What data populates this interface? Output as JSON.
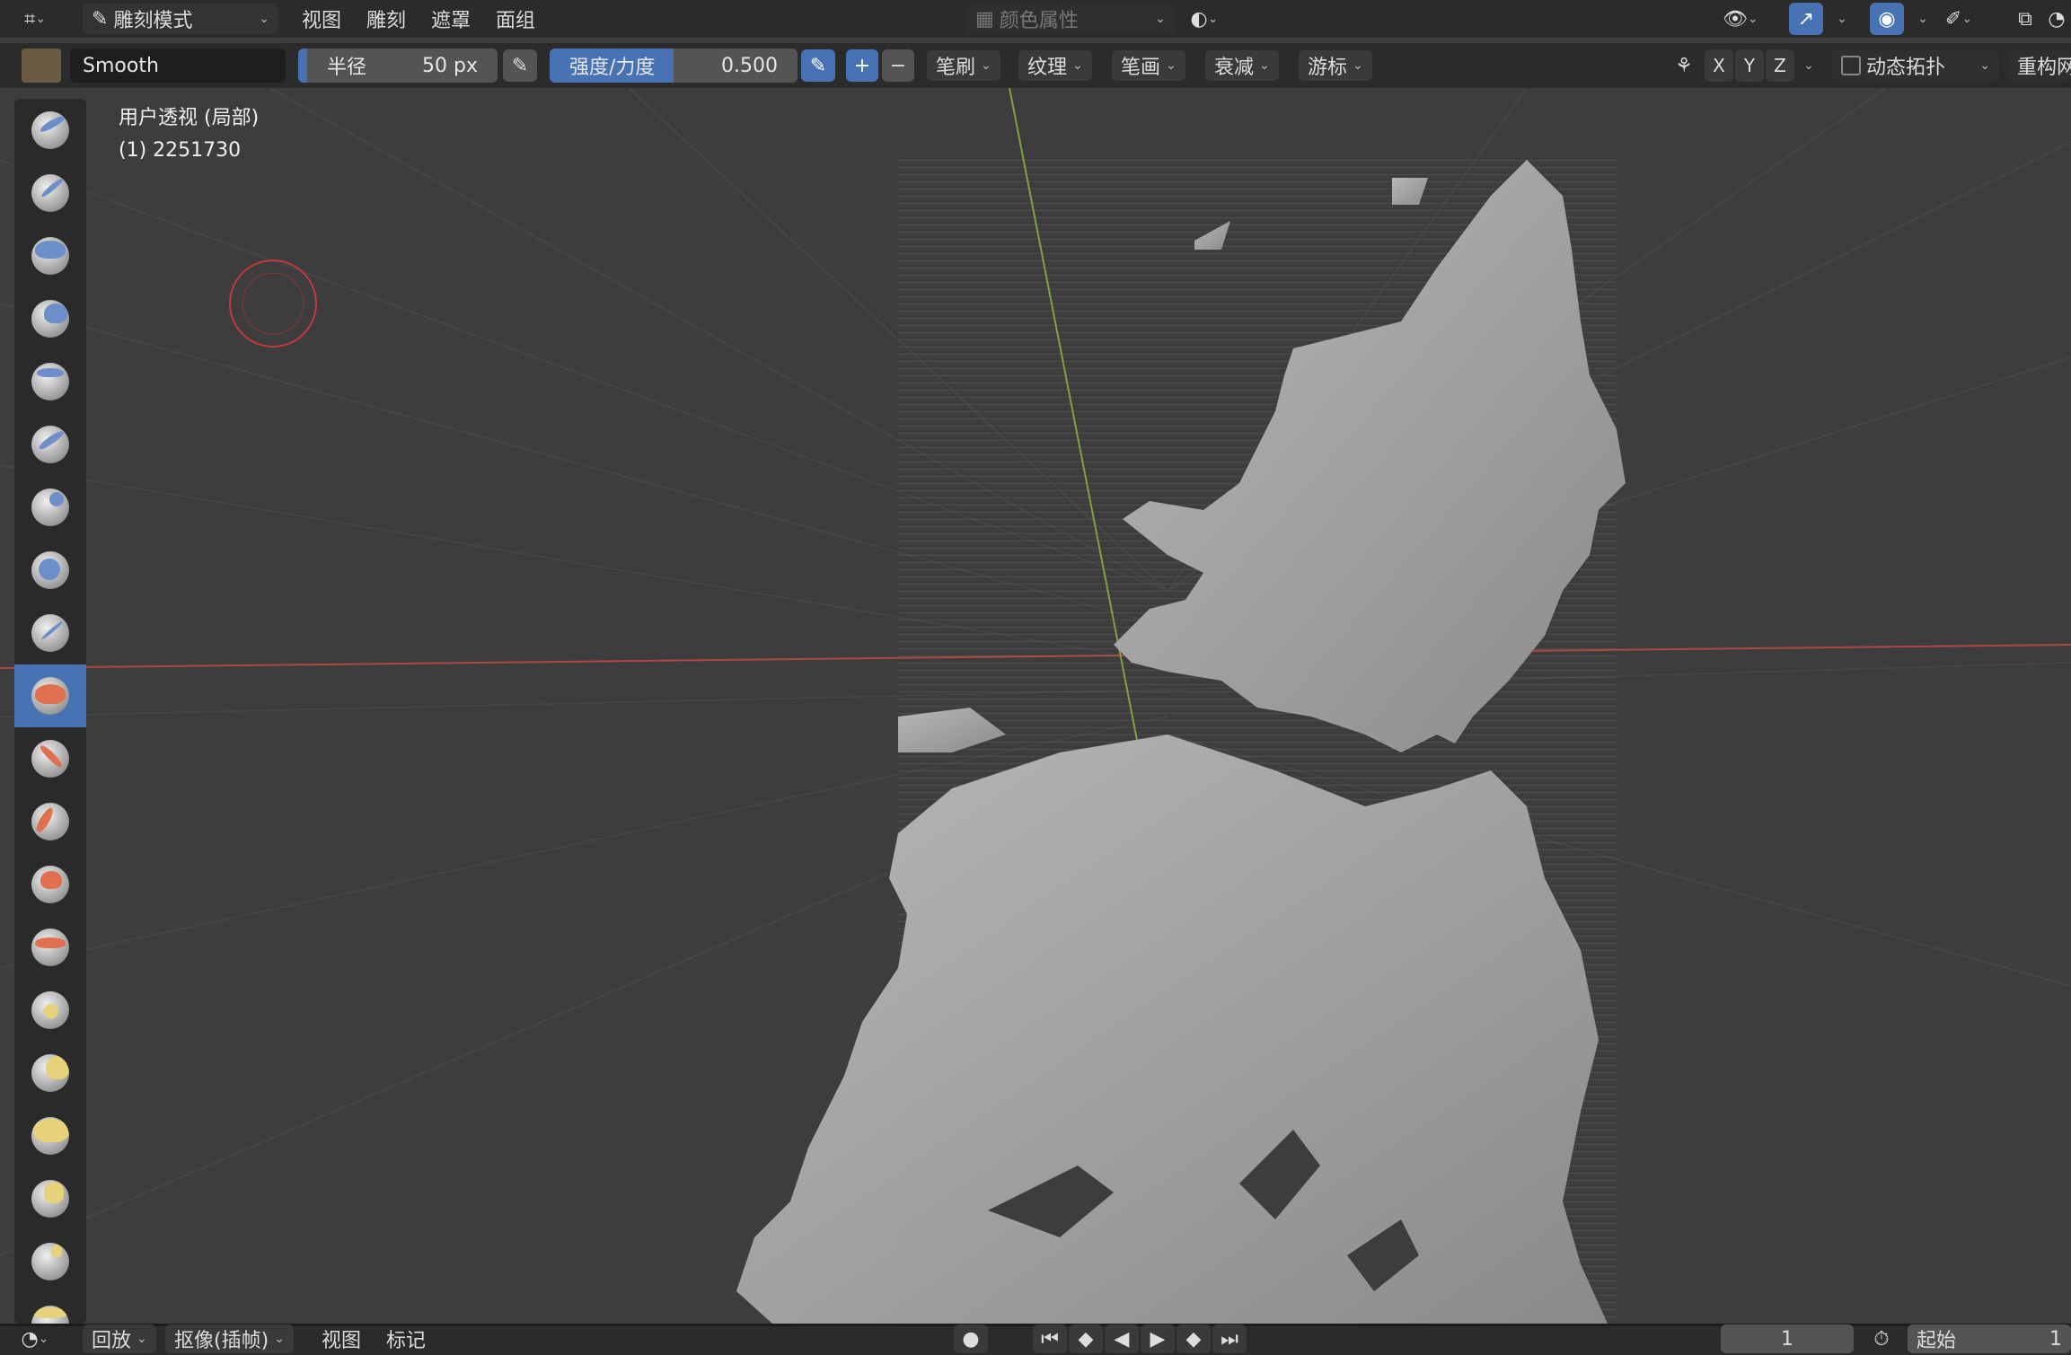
{
  "topbar": {
    "mode_label": "雕刻模式",
    "menus": [
      "视图",
      "雕刻",
      "遮罩",
      "面组"
    ],
    "color_attr_label": "颜色属性"
  },
  "tool_header": {
    "brush_name": "Smooth",
    "radius_label": "半径",
    "radius_value": "50 px",
    "strength_label": "强度/力度",
    "strength_value": "0.500",
    "plus": "+",
    "minus": "−",
    "dropdowns": [
      "笔刷",
      "纹理",
      "笔画",
      "衰减",
      "游标"
    ],
    "axes": [
      "X",
      "Y",
      "Z"
    ],
    "dyntopo_label": "动态拓扑",
    "remesh_label": "重构网"
  },
  "viewport": {
    "view_name": "用户透视 (局部)",
    "object_info": "(1) 2251730"
  },
  "timeline": {
    "menus": [
      "回放",
      "抠像(插帧)",
      "视图",
      "标记"
    ],
    "current_frame": "1",
    "start_label": "起始",
    "start_value": "1"
  },
  "colors": {
    "accent": "#4772b3",
    "x_axis": "#b04646",
    "y_axis": "#7fa33a",
    "brush_cursor": "#c23a3a",
    "mesh": "#a8a8a8",
    "background": "#3d3d3d"
  },
  "icons": {
    "editor_type": "grid-icon",
    "mode": "brush-icon",
    "brush_preview": "texture-icon",
    "pressure": "pen-pressure-icon",
    "symmetry": "butterfly-icon",
    "visibility": "eye-icon",
    "gizmo": "gizmo-icon",
    "overlay": "overlay-icon",
    "shading": "shading-icon",
    "xray": "xray-icon"
  }
}
